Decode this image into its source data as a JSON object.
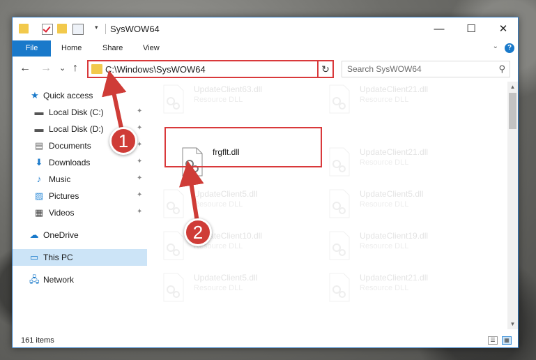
{
  "window": {
    "title": "SysWOW64",
    "minimize_glyph": "—",
    "maximize_glyph": "☐",
    "close_glyph": "✕",
    "qa_dropdown": "▾"
  },
  "ribbon": {
    "file": "File",
    "tabs": [
      "Home",
      "Share",
      "View"
    ],
    "expand_glyph": "⌄",
    "help_glyph": "?"
  },
  "nav": {
    "back": "←",
    "forward": "→",
    "recent": "⌄",
    "up": "↑",
    "address": "C:\\Windows\\SysWOW64",
    "address_dropdown": "⌄",
    "refresh": "↻",
    "search_placeholder": "Search SysWOW64",
    "search_glyph": "⚲"
  },
  "sidebar": {
    "quick_access": "Quick access",
    "pinned": [
      {
        "label": "Local Disk (C:)",
        "icon": "▬",
        "pin": "✦"
      },
      {
        "label": "Local Disk (D:)",
        "icon": "▬",
        "pin": "✦"
      },
      {
        "label": "Documents",
        "icon": "▤",
        "pin": "✦"
      },
      {
        "label": "Downloads",
        "icon": "⬇",
        "pin": "✦"
      },
      {
        "label": "Music",
        "icon": "♪",
        "pin": "✦"
      },
      {
        "label": "Pictures",
        "icon": "▨",
        "pin": "✦"
      },
      {
        "label": "Videos",
        "icon": "▦",
        "pin": "✦"
      }
    ],
    "onedrive": "OneDrive",
    "this_pc": "This PC",
    "network": "Network"
  },
  "files": {
    "left": [
      {
        "name": "UpdateClient63.dll",
        "type": "Resource DLL"
      },
      {
        "name": "frgflt.dll",
        "type": ""
      },
      {
        "name": "UpdateClient5.dll",
        "type": "Resource DLL"
      },
      {
        "name": "UpdateClient10.dll",
        "type": "Resource DLL"
      },
      {
        "name": "UpdateClient5.dll",
        "type": "Resource DLL"
      }
    ],
    "right": [
      {
        "name": "UpdateClient21.dll",
        "type": "Resource DLL"
      },
      {
        "name": "UpdateClient21.dll",
        "type": "Resource DLL"
      },
      {
        "name": "UpdateClient5.dll",
        "type": "Resource DLL"
      },
      {
        "name": "UpdateClient19.dll",
        "type": "Resource DLL"
      },
      {
        "name": "UpdateClient21.dll",
        "type": "Resource DLL"
      }
    ]
  },
  "status": {
    "items": "161 items"
  },
  "annotations": {
    "step1": "1",
    "step2": "2",
    "color": "#cf3c37"
  }
}
